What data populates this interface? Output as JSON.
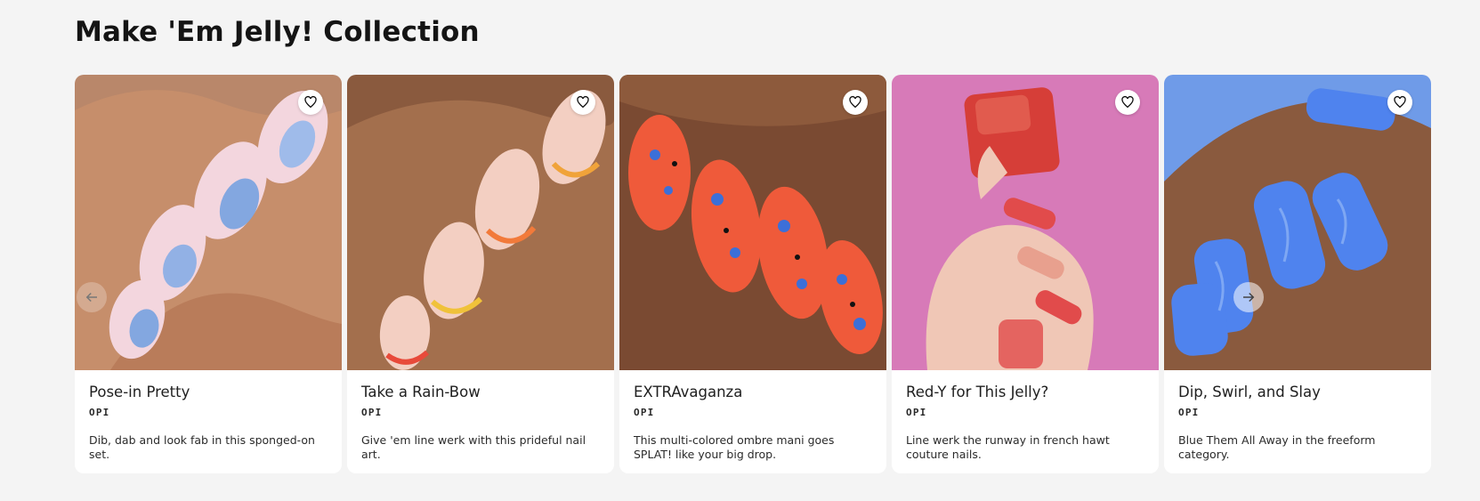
{
  "section": {
    "title": "Make 'Em Jelly! Collection"
  },
  "carousel": {
    "prev_icon": "arrow-left-icon",
    "next_icon": "arrow-right-icon",
    "cards": [
      {
        "title": "Pose-in Pretty",
        "brand": "OPI",
        "description": "Dib, dab and look fab in this sponged-on set.",
        "favorite_icon": "heart-icon",
        "palette": {
          "bg": "#b9876a",
          "skin": "#c68e6b",
          "nail": "#f3d6de",
          "accent": "#6f9fe0"
        }
      },
      {
        "title": "Take a Rain-Bow",
        "brand": "OPI",
        "description": "Give 'em line werk with this prideful nail art.",
        "favorite_icon": "heart-icon",
        "palette": {
          "bg": "#8a5a3e",
          "skin": "#a36f4d",
          "nail": "#f3cfc2",
          "accent": "#f0a33a"
        }
      },
      {
        "title": "EXTRAvaganza",
        "brand": "OPI",
        "description": "This multi-colored ombre mani goes SPLAT! like your big drop.",
        "favorite_icon": "heart-icon",
        "palette": {
          "bg": "#7a4a32",
          "skin": "#8d5a3c",
          "nail": "#ef5a3a",
          "accent": "#3c6fd8"
        }
      },
      {
        "title": "Red-Y for This Jelly?",
        "brand": "OPI",
        "description": "Line werk the runway in french hawt couture nails.",
        "favorite_icon": "heart-icon",
        "palette": {
          "bg": "#d77ab8",
          "skin": "#f0c7b6",
          "nail": "#e14b4b",
          "accent": "#d93a38"
        }
      },
      {
        "title": "Dip, Swirl, and Slay",
        "brand": "OPI",
        "description": "Blue Them All Away in the freeform category.",
        "favorite_icon": "heart-icon",
        "palette": {
          "bg": "#6f9be8",
          "skin": "#8a5a3e",
          "nail": "#4f83ee",
          "accent": "#3a6ad9"
        }
      }
    ]
  }
}
